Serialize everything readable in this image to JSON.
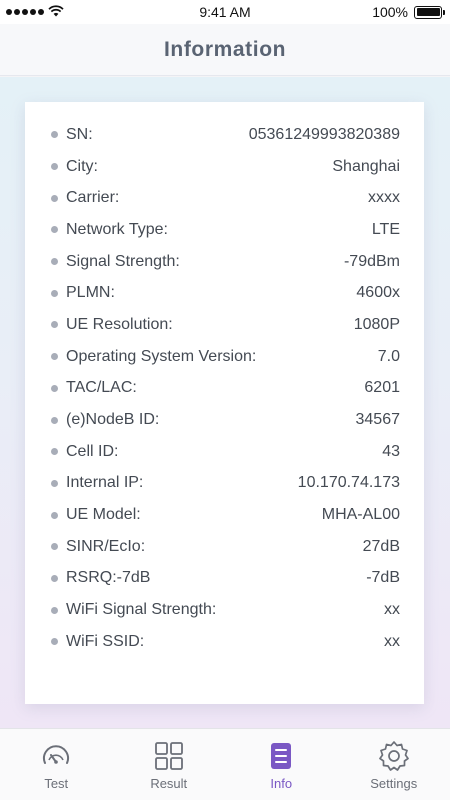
{
  "status_bar": {
    "time": "9:41 AM",
    "battery_text": "100%",
    "signal_dots": 5,
    "wifi_icon": "wifi-icon",
    "battery_icon": "battery-icon",
    "battery_level": 1.0
  },
  "header": {
    "title": "Information"
  },
  "info": {
    "rows": [
      {
        "label": "SN:",
        "value": "05361249993820389"
      },
      {
        "label": "City:",
        "value": "Shanghai"
      },
      {
        "label": "Carrier:",
        "value": "xxxx"
      },
      {
        "label": "Network Type:",
        "value": "LTE"
      },
      {
        "label": "Signal Strength:",
        "value": "-79dBm"
      },
      {
        "label": "PLMN:",
        "value": "4600x"
      },
      {
        "label": "UE Resolution:",
        "value": "1080P"
      },
      {
        "label": "Operating System Version:",
        "value": "7.0"
      },
      {
        "label": "TAC/LAC:",
        "value": "6201"
      },
      {
        "label": "(e)NodeB ID:",
        "value": "34567"
      },
      {
        "label": "Cell ID:",
        "value": "43"
      },
      {
        "label": "Internal IP:",
        "value": "10.170.74.173"
      },
      {
        "label": "UE Model:",
        "value": "MHA-AL00"
      },
      {
        "label": "SINR/EcIo:",
        "value": "27dB"
      },
      {
        "label": "RSRQ:-7dB",
        "value": "-7dB"
      },
      {
        "label": "WiFi Signal Strength:",
        "value": "xx"
      },
      {
        "label": "WiFi SSID:",
        "value": "xx"
      }
    ]
  },
  "tabs": [
    {
      "label": "Test",
      "icon": "speedometer-icon",
      "active": false
    },
    {
      "label": "Result",
      "icon": "grid-icon",
      "active": false
    },
    {
      "label": "Info",
      "icon": "document-icon",
      "active": true
    },
    {
      "label": "Settings",
      "icon": "gear-icon",
      "active": false
    }
  ],
  "colors": {
    "accent": "#7a58c4",
    "inactive_icon": "#6b6f78",
    "title": "#5a6473"
  }
}
